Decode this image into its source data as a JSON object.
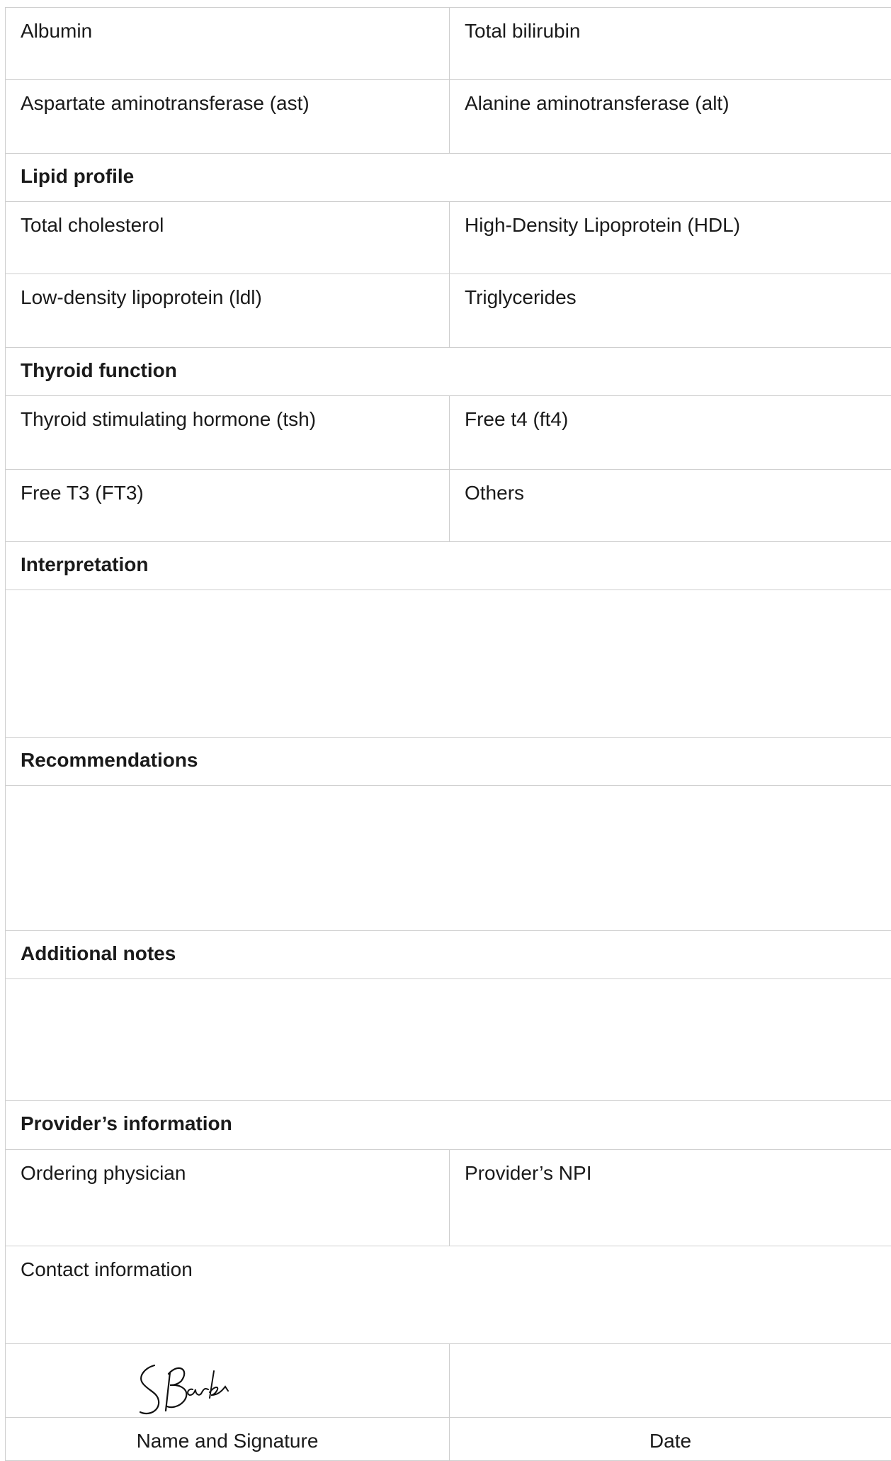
{
  "liver": {
    "albumin": "Albumin",
    "total_bilirubin": "Total bilirubin",
    "ast": "Aspartate aminotransferase (ast)",
    "alt": "Alanine aminotransferase (alt)"
  },
  "lipid": {
    "heading": "Lipid profile",
    "total_cholesterol": "Total cholesterol",
    "hdl": "High-Density Lipoprotein (HDL)",
    "ldl": "Low-density lipoprotein (ldl)",
    "triglycerides": "Triglycerides"
  },
  "thyroid": {
    "heading": "Thyroid function",
    "tsh": "Thyroid stimulating hormone (tsh)",
    "ft4": "Free t4 (ft4)",
    "ft3": "Free T3 (FT3)",
    "others": "Others"
  },
  "interpretation": {
    "heading": "Interpretation"
  },
  "recommendations": {
    "heading": "Recommendations"
  },
  "notes": {
    "heading": "Additional notes"
  },
  "provider": {
    "heading": "Provider’s information",
    "ordering_physician": "Ordering physician",
    "npi": "Provider’s NPI",
    "contact": "Contact information"
  },
  "signature": {
    "name_label": "Name and Signature",
    "date_label": "Date",
    "signature_text": "SBarks"
  }
}
